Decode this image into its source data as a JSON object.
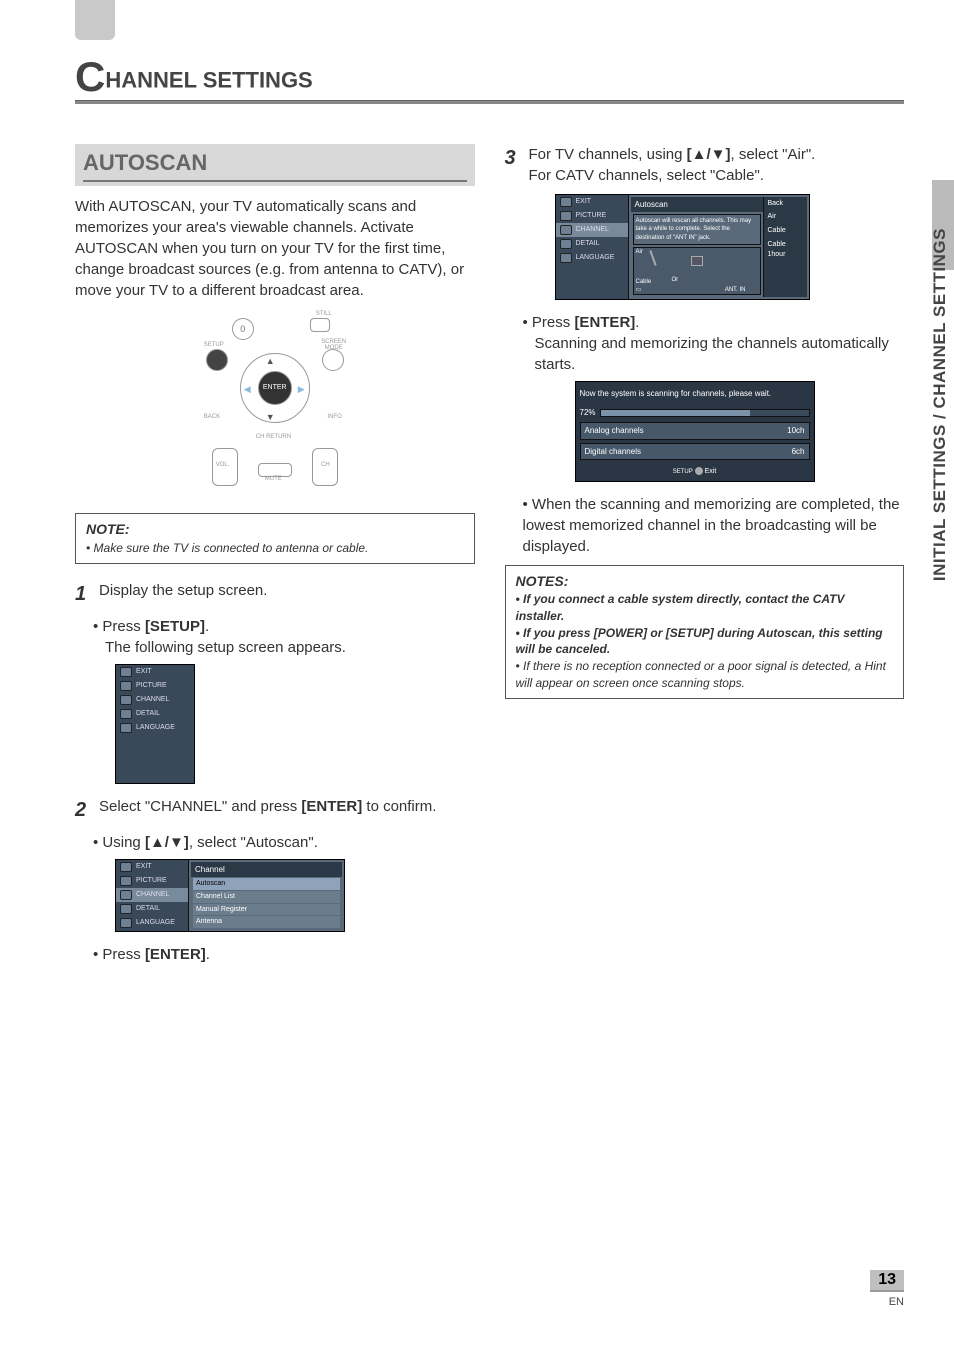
{
  "chapter": {
    "big": "C",
    "rest": "HANNEL SETTINGS"
  },
  "side_tab": "INITIAL SETTINGS / CHANNEL SETTINGS",
  "section_title": "AUTOSCAN",
  "intro": "With AUTOSCAN, your TV automatically scans and memorizes your area's viewable channels. Activate AUTOSCAN when you turn on your TV for the first time, change broadcast sources (e.g. from antenna to CATV), or move your TV to a different broadcast area.",
  "remote": {
    "zero": "0",
    "still": "STILL",
    "setup": "SETUP",
    "screen_mode": "SCREEN MODE",
    "enter": "ENTER",
    "back": "BACK",
    "info": "INFO",
    "ch_return": "CH RETURN",
    "vol": "VOL.",
    "mute": "MUTE",
    "ch": "CH"
  },
  "note1": {
    "head": "NOTE:",
    "body": "• Make sure the TV is connected to antenna or cable."
  },
  "steps": {
    "s1": {
      "num": "1",
      "text": "Display the setup screen.",
      "sub1": "Press ",
      "sub1_bold": "[SETUP]",
      "sub1_tail": ".",
      "sub2": "The following setup screen appears."
    },
    "s2": {
      "num": "2",
      "text_a": "Select \"CHANNEL\" and press ",
      "text_bold": "[ENTER]",
      "text_b": " to confirm.",
      "sub_a": "Using ",
      "sub_bold": "[▲/▼]",
      "sub_b": ", select \"Autoscan\".",
      "press1": "Press ",
      "press1_bold": "[ENTER]",
      "press1_tail": "."
    },
    "s3": {
      "num": "3",
      "line1_a": "For TV channels, using ",
      "line1_bold": "[▲/▼]",
      "line1_b": ", select \"Air\".",
      "line2": "For CATV channels, select \"Cable\".",
      "press_a": "Press ",
      "press_bold": "[ENTER]",
      "press_tail": ".",
      "scan_line": "Scanning and memorizing the channels automatically starts.",
      "complete": "When the scanning and memorizing are completed, the lowest memorized channel in the broadcasting will be displayed."
    }
  },
  "osd_menu": {
    "items": [
      "EXIT",
      "PICTURE",
      "CHANNEL",
      "DETAIL",
      "LANGUAGE"
    ]
  },
  "osd_channel": {
    "title": "Channel",
    "rows": [
      "Autoscan",
      "Channel List",
      "Manual Register",
      "Antenna"
    ]
  },
  "osd_autoscan": {
    "title": "Autoscan",
    "box1": "Autoscan will rescan all channels. This may take a while to complete. Select the destination of \"ANT IN\" jack.",
    "air": "Air",
    "cable": "Cable",
    "or": "Or",
    "ant_in": "ANT. IN",
    "far": [
      "Back",
      "Air",
      "Cable",
      "Cable 1hour"
    ]
  },
  "progress": {
    "header": "Now the system is scanning for channels, please wait.",
    "percent": "72%",
    "rows": [
      {
        "label": "Analog channels",
        "val": "10ch"
      },
      {
        "label": "Digital channels",
        "val": "6ch"
      }
    ],
    "footer_btn": "SETUP",
    "footer_label": "Exit"
  },
  "notes2": {
    "head": "NOTES:",
    "items": [
      "If you connect a cable system directly, contact the CATV installer.",
      "If you press [POWER] or [SETUP] during Autoscan, this setting will be canceled.",
      "If there is no reception connected or a poor signal is detected, a Hint will appear on screen once scanning stops."
    ]
  },
  "page_number": "13",
  "page_lang": "EN"
}
